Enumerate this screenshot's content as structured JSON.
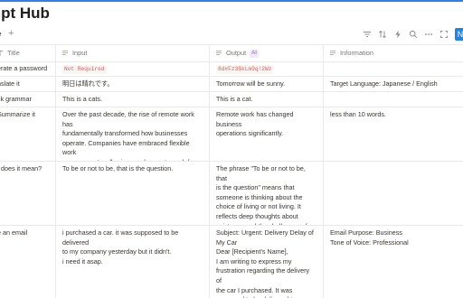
{
  "page": {
    "title": "mpt Hub"
  },
  "viewbar": {
    "tab_label": "e",
    "add_label": "+",
    "new_label": "N"
  },
  "columns": [
    {
      "label": "Title",
      "icon": "text-icon"
    },
    {
      "label": "Input",
      "icon": "text-lines-icon"
    },
    {
      "label": "Output",
      "icon": "text-lines-icon",
      "badge": "AI"
    },
    {
      "label": "Information",
      "icon": "text-lines-icon"
    }
  ],
  "rows": [
    {
      "title": "erate a password",
      "input": "Not Required",
      "output": "8d#Fz3$kLm9q!2Wz",
      "info": ""
    },
    {
      "title": "nslate it",
      "input": "明日は晴れです。",
      "output": "Tomorrow will be sunny.",
      "info": "Target Language: Japanese / English"
    },
    {
      "title": "ck grammar",
      "input": "This is a cats.",
      "output": "This is a cat.",
      "info": ""
    },
    {
      "title": "Summarize it",
      "input": "Over the past decade, the rise of remote work has\nfundamentally transformed how businesses\noperate. Companies have embraced flexible work\narrangements, allowing employees to work from\nanywhere with an internet connection.",
      "output": "Remote work has changed business\noperations significantly.",
      "info": "less than 10 words."
    },
    {
      "title": "t does it mean?",
      "input": "To be or not to be, that is the question.",
      "output": "The phrase \"To be or not to be, that\nis the question\" means that\nsomeone is thinking about the\nchoice of living or not living. It\nreflects deep thoughts about\nexistence and the challenges of life.",
      "info": ""
    },
    {
      "title": "e an email",
      "input": "i purchased a car. it was supposed to be delivered\nto my company yesterday but it didn't.\ni need it asap.",
      "output": "Subject: Urgent: Delivery Delay of\nMy Car\nDear [Recipient's Name],\nI am writing to express my\nfrustration regarding the delivery of\nthe car I purchased. It was\nsupposed to be delivered to my",
      "info": "Email Purpose: Business\nTone of Voice: Professional"
    }
  ],
  "colors": {
    "accent": "#2383e2",
    "code_text": "#eb5757",
    "border": "#e9e9e7"
  }
}
